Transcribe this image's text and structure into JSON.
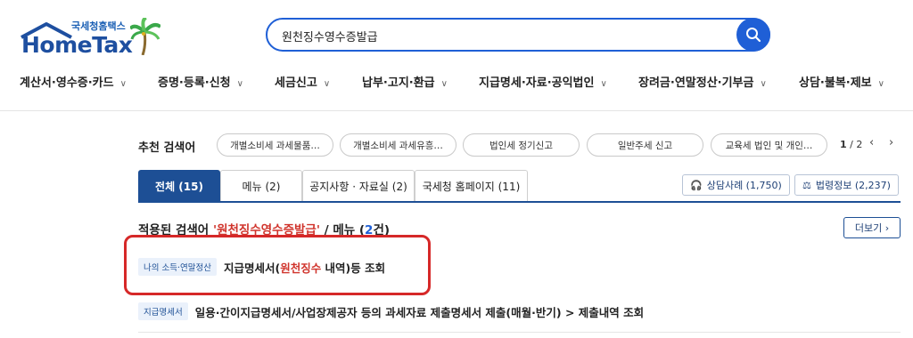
{
  "brand": {
    "name": "HomeTax",
    "subtitle": "국세청홈택스"
  },
  "search": {
    "value": "원천징수영수증발급",
    "icon": "search-icon"
  },
  "gnb": [
    {
      "label": "계산서·영수증·카드"
    },
    {
      "label": "증명·등록·신청"
    },
    {
      "label": "세금신고"
    },
    {
      "label": "납부·고지·환급"
    },
    {
      "label": "지급명세·자료·공익법인"
    },
    {
      "label": "장려금·연말정산·기부금"
    },
    {
      "label": "상담·불복·제보"
    }
  ],
  "recommended": {
    "label": "추천 검색어",
    "chips": [
      "개별소비세 과세물품…",
      "개별소비세 과세유흥…",
      "법인세 정기신고",
      "일반주세 신고",
      "교육세 법인 및 개인…"
    ],
    "page_current": "1",
    "page_total": "/ 2"
  },
  "tabs": [
    {
      "label": "전체 (15)",
      "active": true
    },
    {
      "label": "메뉴 (2)"
    },
    {
      "label": "공지사항 · 자료실 (2)"
    },
    {
      "label": "국세청 홈페이지 (11)"
    }
  ],
  "side_buttons": {
    "consult": "상담사례 (1,750)",
    "law": "법령정보 (2,237)"
  },
  "result_header": {
    "prefix": "적용된 검색어",
    "keyword": "'원천징수영수증발급'",
    "mid": "/ 메뉴 (",
    "count": "2",
    "suffix": "건)",
    "more": "더보기"
  },
  "results": [
    {
      "tag": "나의 소득·연말정산",
      "text_before": "지급명세서(",
      "text_hl": "원천징수",
      "text_after": " 내역)등 조회"
    },
    {
      "tag": "지급명세서",
      "text": "일용·간이지급명세서/사업장제공자 등의 과세자료 제출명세서 제출(매월·반기) > 제출내역 조회"
    }
  ],
  "colors": {
    "primary": "#1d4f95",
    "accent": "#1f5fd6",
    "highlight": "#d0342c",
    "annotation": "#d62828"
  }
}
